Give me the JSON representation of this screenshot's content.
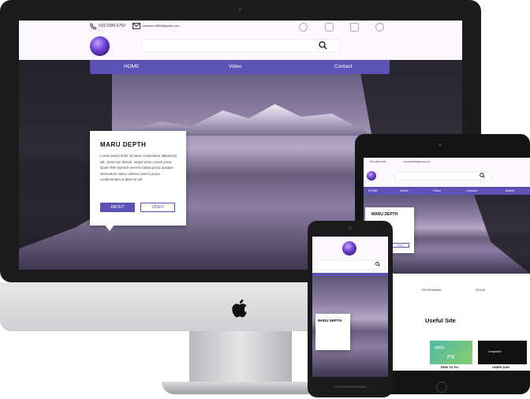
{
  "site": {
    "phone": "010-2389-6753",
    "email": "marudev4835@gmail.com",
    "search_placeholder": "",
    "nav": [
      "HOME",
      "Video",
      "Contact"
    ],
    "card_title": "MARU DEPTH",
    "card_text": "Lorem ipsum dolor sit amet, consectetur adipiscing elit. Justo non dictum, neque enim cursus porta. Quam felis egestas viverra massa purus quisque elementum netus. Ultrices viverra purus condimentum ut diam sit elit.",
    "btn_about": "ABOUT",
    "btn_video": "VIDEO"
  },
  "tablet": {
    "phone": "010-2389-6753",
    "email": "marudev4835@gmail.com",
    "nav": [
      "HOME",
      "About",
      "Video",
      "Contact",
      "Admin"
    ],
    "card_title": "MARU DEPTH",
    "btn_video": "VIDEO",
    "features": [
      "PROGRAMMING",
      "DESIGN"
    ],
    "useful_title": "Useful Site",
    "tiles": [
      "REM TO PX",
      "UNSPLASH"
    ],
    "tile_rem": "rem",
    "tile_px": "PX",
    "tile_unsplash_logo": "Unsplash"
  },
  "mobile": {
    "card_title": "MARU DEPTH"
  },
  "colors": {
    "accent": "#5b52b5",
    "bezel": "#1c1c1e"
  }
}
